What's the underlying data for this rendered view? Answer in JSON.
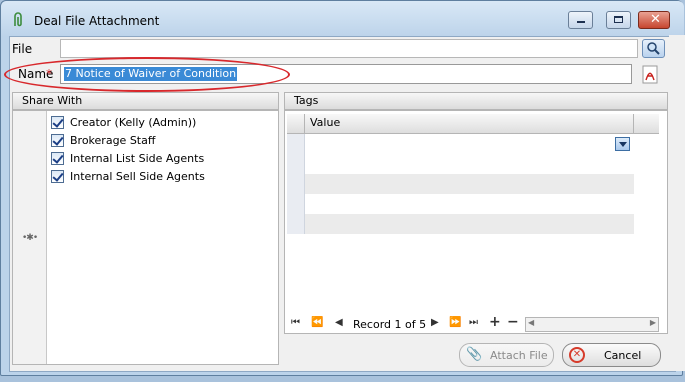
{
  "window": {
    "title": "Deal File Attachment",
    "icons": [
      "paperclip-icon",
      "minimize-icon",
      "maximize-icon",
      "close-icon"
    ]
  },
  "file": {
    "label": "File",
    "value": ""
  },
  "name": {
    "label": "Name",
    "required_marker": "*",
    "value": "7 Notice of Waiver of Condition"
  },
  "share_with": {
    "title": "Share With",
    "items": [
      {
        "label": "Creator (Kelly (Admin))",
        "checked": true
      },
      {
        "label": "Brokerage Staff",
        "checked": true
      },
      {
        "label": "Internal List Side Agents",
        "checked": true
      },
      {
        "label": "Internal Sell Side Agents",
        "checked": true
      }
    ]
  },
  "tags": {
    "title": "Tags",
    "column": "Value",
    "navigator": {
      "record_text": "Record 1 of 5"
    }
  },
  "buttons": {
    "attach": "Attach File",
    "cancel": "Cancel"
  },
  "colors": {
    "selection": "#3a8ad6",
    "annotation": "#d8282c",
    "required": "#d8282c"
  }
}
